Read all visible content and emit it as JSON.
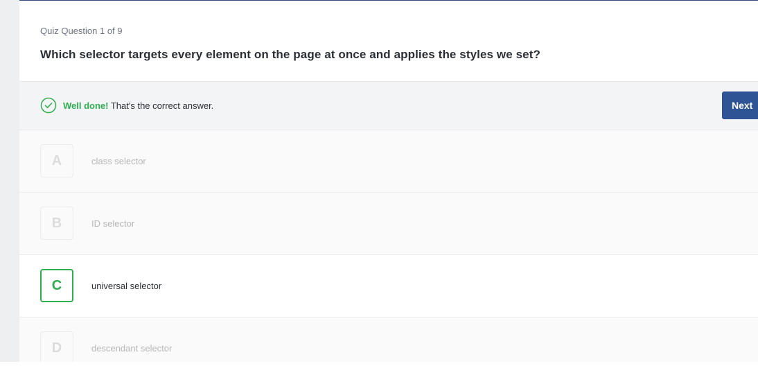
{
  "quiz": {
    "counter": "Quiz Question 1 of 9",
    "question": "Which selector targets every element on the page at once and applies the styles we set?"
  },
  "feedback": {
    "strong": "Well done!",
    "message": " That's the correct answer.",
    "icon": "check-circle-icon",
    "color": "#2eae4f"
  },
  "next_button": {
    "label": "Next"
  },
  "options": [
    {
      "letter": "A",
      "text": "class selector",
      "selected": false
    },
    {
      "letter": "B",
      "text": "ID selector",
      "selected": false
    },
    {
      "letter": "C",
      "text": "universal selector",
      "selected": true
    },
    {
      "letter": "D",
      "text": "descendant selector",
      "selected": false
    }
  ],
  "colors": {
    "accent": "#2f5496",
    "correct": "#2eae4f"
  }
}
